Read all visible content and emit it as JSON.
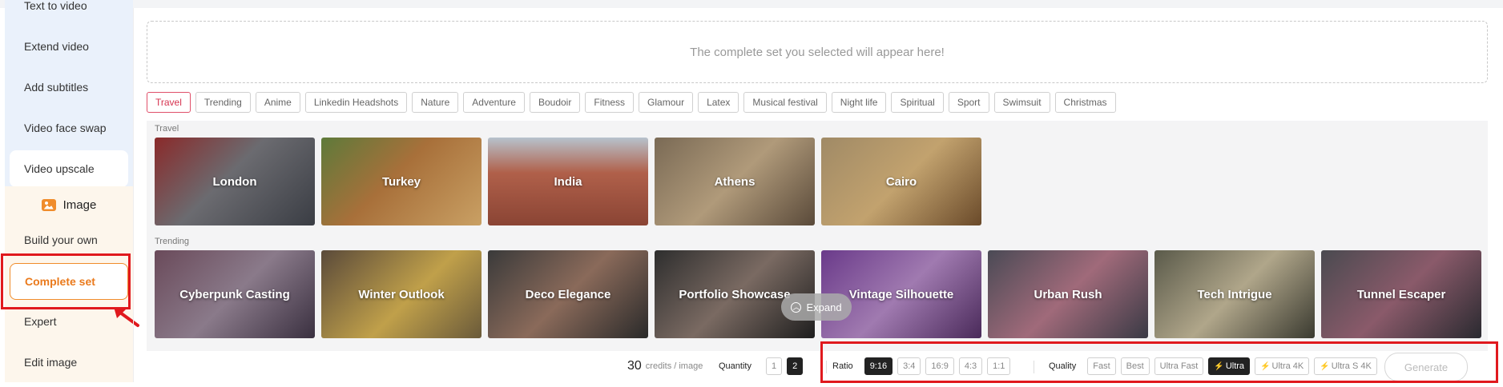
{
  "sidebar": {
    "video_items": [
      {
        "label": "Text to video"
      },
      {
        "label": "Extend video"
      },
      {
        "label": "Add subtitles"
      },
      {
        "label": "Video face swap"
      },
      {
        "label": "Video upscale"
      }
    ],
    "image_header": "Image",
    "image_items": [
      {
        "label": "Build your own"
      },
      {
        "label": "Complete set"
      },
      {
        "label": "Expert"
      },
      {
        "label": "Edit image"
      }
    ]
  },
  "main": {
    "placeholder": "The complete set you selected will appear here!",
    "tabs": [
      "Travel",
      "Trending",
      "Anime",
      "Linkedin Headshots",
      "Nature",
      "Adventure",
      "Boudoir",
      "Fitness",
      "Glamour",
      "Latex",
      "Musical festival",
      "Night life",
      "Spiritual",
      "Sport",
      "Swimsuit",
      "Christmas"
    ],
    "active_tab": "Travel",
    "sections": [
      {
        "label": "Travel",
        "cards": [
          "London",
          "Turkey",
          "India",
          "Athens",
          "Cairo"
        ]
      },
      {
        "label": "Trending",
        "cards": [
          "Cyberpunk Casting",
          "Winter Outlook",
          "Deco Elegance",
          "Portfolio Showcase",
          "Vintage Silhouette",
          "Urban Rush",
          "Tech Intrigue",
          "Tunnel Escaper"
        ]
      }
    ],
    "expand_label": "Expand"
  },
  "bottom_bar": {
    "credits_value": "30",
    "credits_unit": "credits / image",
    "quantity_label": "Quantity",
    "quantity_options": [
      "1",
      "2"
    ],
    "quantity_selected": "2",
    "ratio_label": "Ratio",
    "ratio_options": [
      "9:16",
      "3:4",
      "16:9",
      "4:3",
      "1:1"
    ],
    "ratio_selected": "9:16",
    "quality_label": "Quality",
    "quality_options": [
      "Fast",
      "Best",
      "Ultra Fast",
      "Ultra",
      "Ultra 4K",
      "Ultra S 4K"
    ],
    "quality_selected": "Ultra",
    "generate_label": "Generate"
  },
  "colors": {
    "accent_orange": "#ea7a1c",
    "highlight_red": "#e0191e",
    "active_tab_pink": "#d6334f",
    "selected_dark": "#222222",
    "bolt_yellow": "#f3b019"
  }
}
